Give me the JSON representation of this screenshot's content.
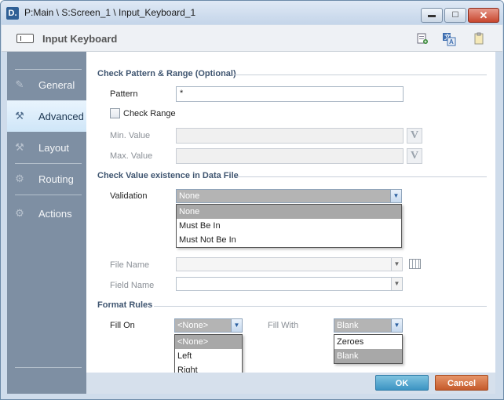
{
  "window": {
    "app_icon": "D.",
    "title": "P:Main \\ S:Screen_1 \\ Input_Keyboard_1",
    "controls": {
      "minimize": "▬",
      "maximize": "☐",
      "close": "✕"
    }
  },
  "header": {
    "title": "Input Keyboard",
    "icons": [
      "add-page-icon",
      "translate-icon",
      "clipboard-icon"
    ]
  },
  "sidebar": {
    "items": [
      {
        "label": "General",
        "icon": "wrench-icon",
        "active": false
      },
      {
        "label": "Advanced",
        "icon": "wrench-gear-icon",
        "active": true
      },
      {
        "label": "Layout",
        "icon": "layout-icon",
        "active": false
      },
      {
        "label": "Routing",
        "icon": "gear-icon",
        "active": false
      },
      {
        "label": "Actions",
        "icon": "actions-icon",
        "active": false
      }
    ]
  },
  "check_pattern": {
    "heading": "Check Pattern & Range (Optional)",
    "pattern_label": "Pattern",
    "pattern_value": "*",
    "check_range_label": "Check Range",
    "check_range_checked": false,
    "min_label": "Min. Value",
    "max_label": "Max. Value",
    "v_button": "V"
  },
  "check_value": {
    "heading": "Check Value existence in Data File",
    "validation_label": "Validation",
    "validation_value": "None",
    "validation_options": [
      "None",
      "Must Be In",
      "Must Not Be In"
    ],
    "file_name_label": "File Name",
    "field_name_label": "Field Name"
  },
  "format_rules": {
    "heading": "Format Rules",
    "fill_on_label": "Fill On",
    "fill_on_value": "<None>",
    "fill_on_options": [
      "<None>",
      "Left",
      "Right"
    ],
    "fill_with_label": "Fill  With",
    "fill_with_value": "Blank",
    "fill_with_options": [
      "Zeroes",
      "Blank"
    ]
  },
  "footer": {
    "ok_label": "OK",
    "cancel_label": "Cancel"
  }
}
